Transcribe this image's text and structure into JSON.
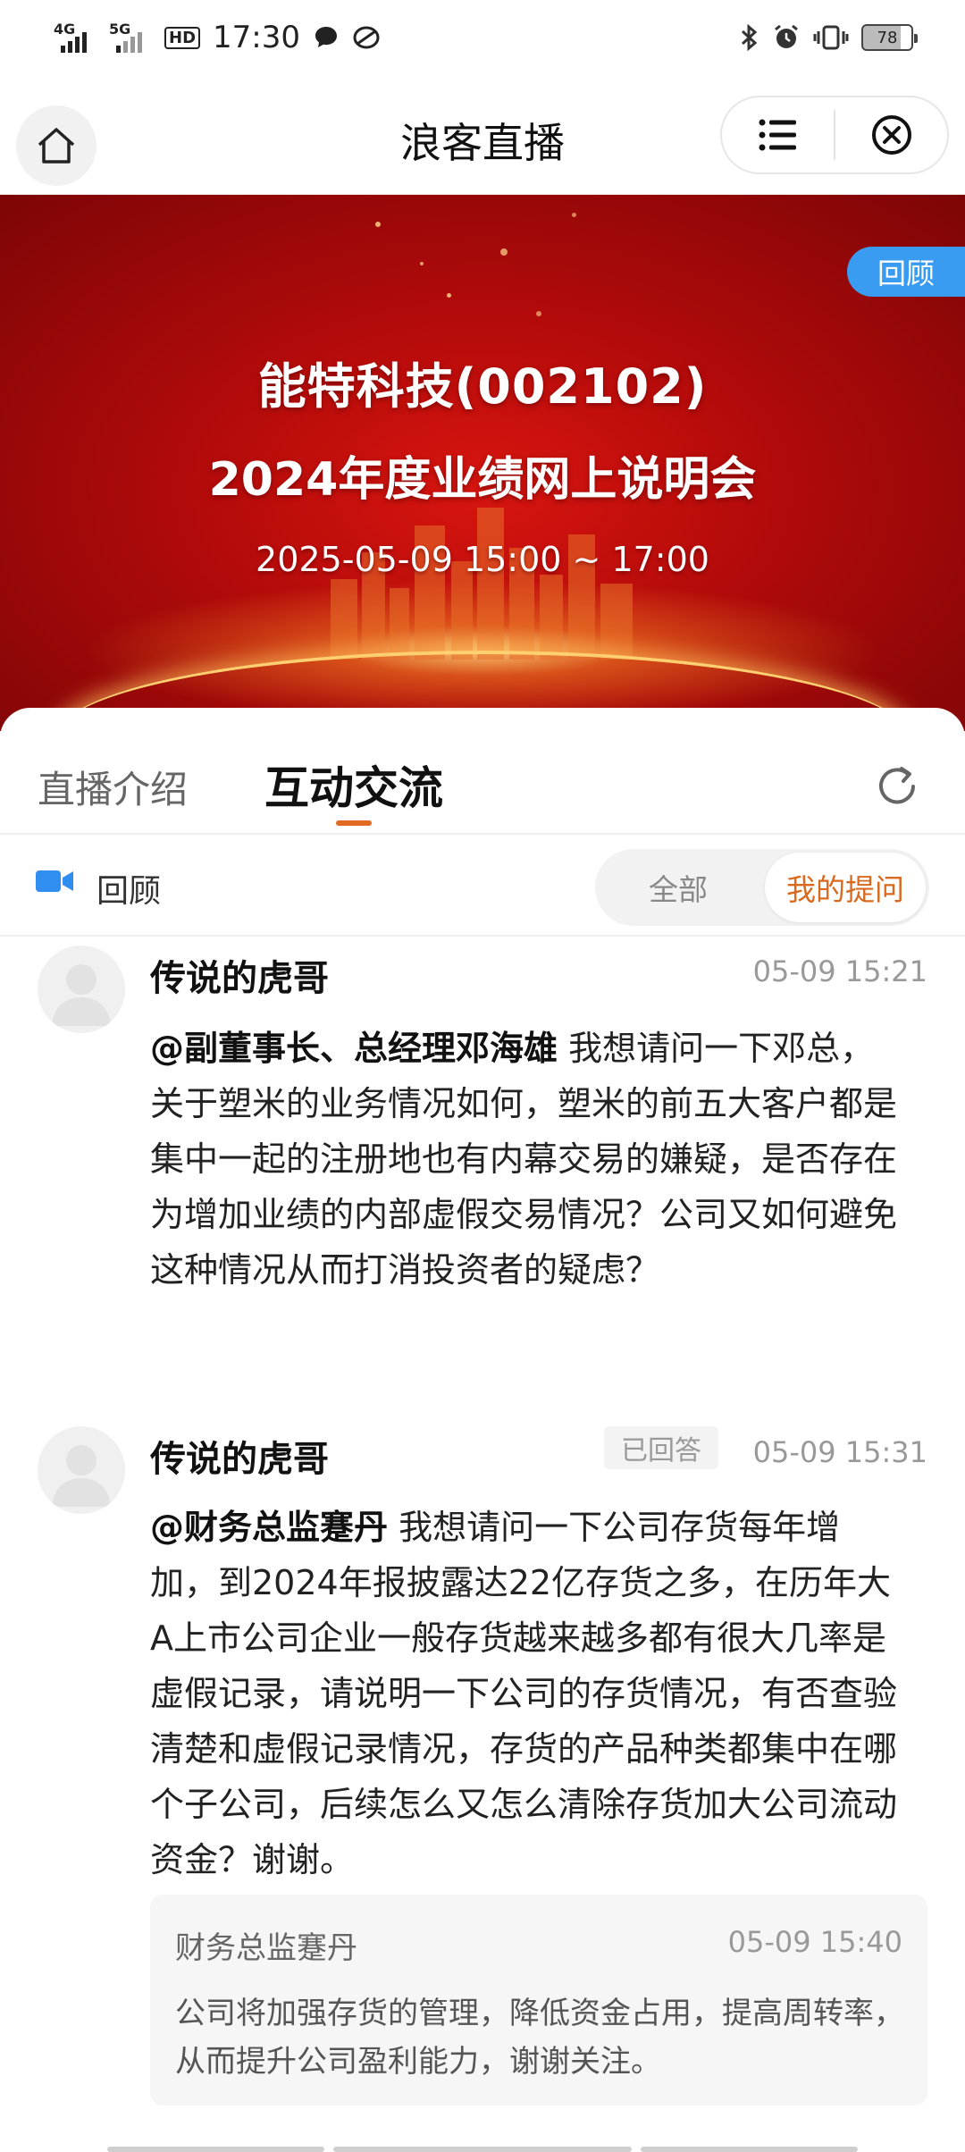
{
  "status_bar": {
    "network1": "4G",
    "network2": "5G",
    "hd": "HD",
    "time": "17:30",
    "battery": "78"
  },
  "nav": {
    "title": "浪客直播"
  },
  "banner": {
    "title": "能特科技(002102)",
    "subtitle": "2024年度业绩网上说明会",
    "time": "2025-05-09 15:00 ~ 17:00",
    "badge": "回顾"
  },
  "tabs": {
    "intro": "直播介绍",
    "interact": "互动交流"
  },
  "filter": {
    "replay_label": "回顾",
    "all": "全部",
    "mine": "我的提问"
  },
  "messages": [
    {
      "user": "传说的虎哥",
      "time": "05-09 15:21",
      "mention": "@副董事长、总经理邓海雄",
      "text": " 我想请问一下邓总，关于塑米的业务情况如何，塑米的前五大客户都是集中一起的注册地也有内幕交易的嫌疑，是否存在为增加业绩的内部虚假交易情况？公司又如何避免这种情况从而打消投资者的疑虑？"
    },
    {
      "user": "传说的虎哥",
      "status": "已回答",
      "time": "05-09 15:31",
      "mention": "@财务总监蹇丹",
      "text": " 我想请问一下公司存货每年增加，到2024年报披露达22亿存货之多，在历年大A上市公司企业一般存货越来越多都有很大几率是虚假记录，请说明一下公司的存货情况，有否查验清楚和虚假记录情况，存货的产品种类都集中在哪个子公司，后续怎么又怎么清除存货加大公司流动资金？谢谢。",
      "reply": {
        "name": "财务总监蹇丹",
        "time": "05-09 15:40",
        "text": "公司将加强存货的管理，降低资金占用，提高周转率，从而提升公司盈利能力，谢谢关注。"
      }
    }
  ],
  "colors": {
    "accent": "#e26a23",
    "badge_blue": "#3a9cf0",
    "banner_red": "#b00a0a"
  }
}
